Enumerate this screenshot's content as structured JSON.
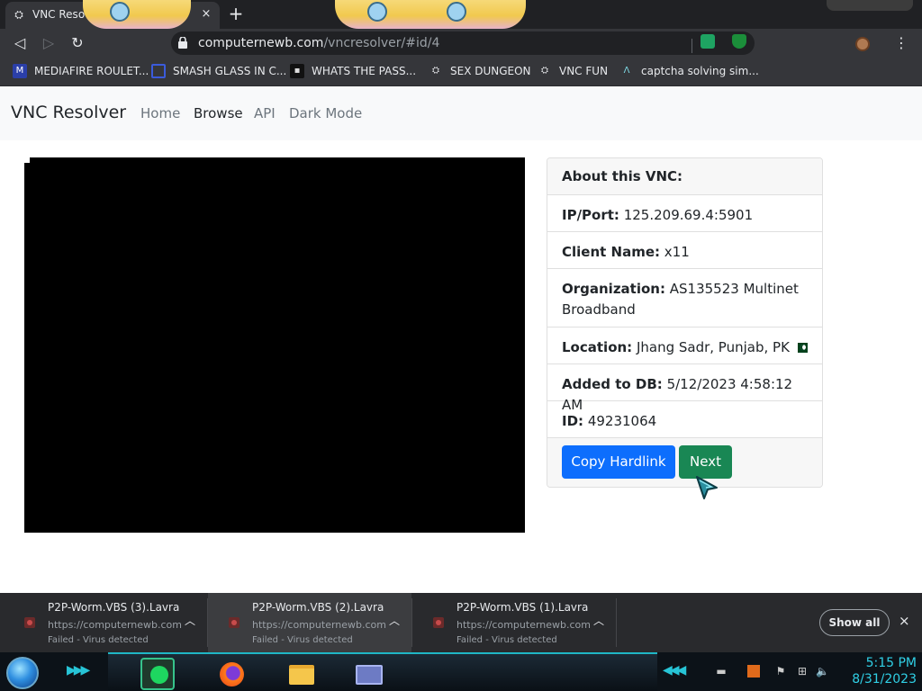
{
  "browser": {
    "tab": {
      "title": "VNC Reso",
      "favicon": "vnc-icon",
      "close": "×"
    },
    "new_tab": "+",
    "address": {
      "host": "computernewb.com",
      "path": "/vncresolver/",
      "path_tail": "#id/4"
    },
    "toolbar": {
      "back": "◁",
      "forward": "▷",
      "reload": "↻",
      "menu": "⋮"
    }
  },
  "bookmarks": [
    {
      "label": "MEDIAFIRE ROULET...",
      "icon": "mediafire-icon",
      "icon_text": "M"
    },
    {
      "label": "SMASH GLASS IN C...",
      "icon": "bookmark-square-icon",
      "icon_text": ""
    },
    {
      "label": "WHATS THE PASS...",
      "icon": "bookmark-dark-icon",
      "icon_text": "▪"
    },
    {
      "label": "SEX DUNGEON",
      "icon": "vnc-icon",
      "icon_text": "⛭"
    },
    {
      "label": "VNC FUN",
      "icon": "vnc-icon",
      "icon_text": "⛭"
    },
    {
      "label": "captcha solving sim...",
      "icon": "caret-icon",
      "icon_text": "Λ"
    }
  ],
  "site": {
    "brand": "VNC Resolver",
    "nav": [
      "Home",
      "Browse",
      "API",
      "Dark Mode"
    ],
    "active_nav": "Browse"
  },
  "vnc": {
    "header": "About this VNC:",
    "ip_label": "IP/Port:",
    "ip_value": "125.209.69.4:5901",
    "client_label": "Client Name:",
    "client_value": "x11",
    "org_label": "Organization:",
    "org_value": "AS135523 Multinet Broadband",
    "location_label": "Location:",
    "location_value": "Jhang Sadr, Punjab, PK",
    "added_label": "Added to DB:",
    "added_value": "5/12/2023 4:58:12 AM",
    "id_label": "ID:",
    "id_value": "49231064",
    "copy_button": "Copy Hardlink",
    "next_button": "Next"
  },
  "downloads": {
    "items": [
      {
        "name": "P2P-Worm.VBS (3).Lavra",
        "url": "https://computernewb.com",
        "status": "Failed - Virus detected"
      },
      {
        "name": "P2P-Worm.VBS (2).Lavra",
        "url": "https://computernewb.com",
        "status": "Failed - Virus detected"
      },
      {
        "name": "P2P-Worm.VBS (1).Lavra",
        "url": "https://computernewb.com",
        "status": "Failed - Virus detected"
      }
    ],
    "show_all": "Show all",
    "close": "×"
  },
  "taskbar": {
    "time": "5:15 PM",
    "date": "8/31/2023",
    "apps": [
      "spotify-icon",
      "firefox-icon",
      "file-explorer-icon",
      "app-window-icon"
    ]
  },
  "colors": {
    "primary": "#0d6efd",
    "success": "#198754",
    "chrome_dark": "#35363a",
    "clock": "#30d0e6"
  }
}
